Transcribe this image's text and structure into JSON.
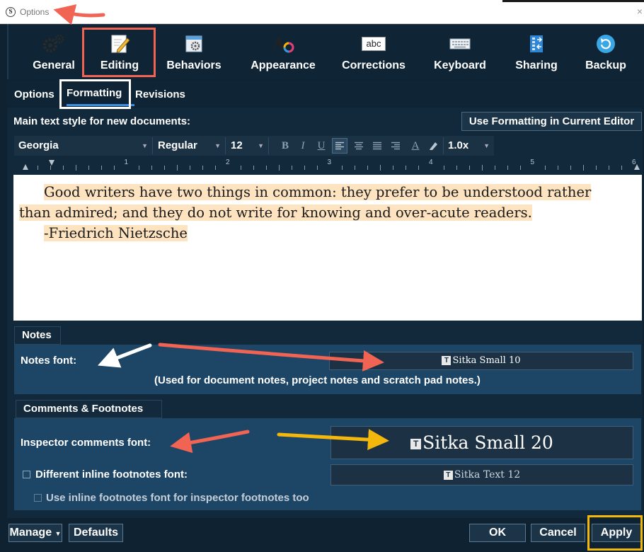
{
  "window": {
    "title": "Options",
    "app_icon_letter": "S",
    "close_glyph": "×"
  },
  "toolbar": {
    "items": [
      {
        "label": "General",
        "icon": "gears-icon"
      },
      {
        "label": "Editing",
        "icon": "pencil-icon"
      },
      {
        "label": "Behaviors",
        "icon": "window-gear-icon"
      },
      {
        "label": "Appearance",
        "icon": "font-color-icon"
      },
      {
        "label": "Corrections",
        "icon": "abc-icon"
      },
      {
        "label": "Keyboard",
        "icon": "keyboard-icon"
      },
      {
        "label": "Sharing",
        "icon": "sharing-icon"
      },
      {
        "label": "Backup",
        "icon": "backup-icon"
      }
    ],
    "abc_text": "abc"
  },
  "subtabs": {
    "items": [
      "Options",
      "Formatting",
      "Revisions"
    ],
    "active": "Formatting"
  },
  "formatting": {
    "main_label": "Main text style for new documents:",
    "use_current_button": "Use Formatting in Current Editor",
    "font_family": "Georgia",
    "font_style": "Regular",
    "font_size": "12",
    "line_spacing": "1.0x",
    "bold_glyph": "B",
    "italic_glyph": "I",
    "underline_glyph": "U",
    "text_color_glyph": "A",
    "ruler_numbers": [
      "1",
      "2",
      "3",
      "4",
      "5",
      "6"
    ]
  },
  "editor": {
    "line1": "Good writers have two things in common: they prefer to be understood rather",
    "line2": "than admired; and they do not write for knowing and over-acute readers.",
    "line3": "-Friedrich Nietzsche"
  },
  "notes": {
    "section_title": "Notes",
    "font_label": "Notes font:",
    "font_value": "Sitka Small 10",
    "usage_text": "(Used for document notes, project notes and scratch pad notes.)"
  },
  "comments": {
    "section_title": "Comments & Footnotes",
    "inspector_label": "Inspector comments font:",
    "inspector_value": "Sitka Small 20",
    "inline_label": "Different inline footnotes font:",
    "inline_value": "Sitka Text 12",
    "use_inline_label": "Use inline footnotes font for inspector footnotes too"
  },
  "footer": {
    "manage": "Manage",
    "defaults": "Defaults",
    "ok": "OK",
    "cancel": "Cancel",
    "apply": "Apply"
  },
  "colors": {
    "accent_blue": "#3a8fe0",
    "annotation_red": "#f16352",
    "annotation_yellow": "#f4b70c",
    "highlight": "#fde3bf"
  }
}
